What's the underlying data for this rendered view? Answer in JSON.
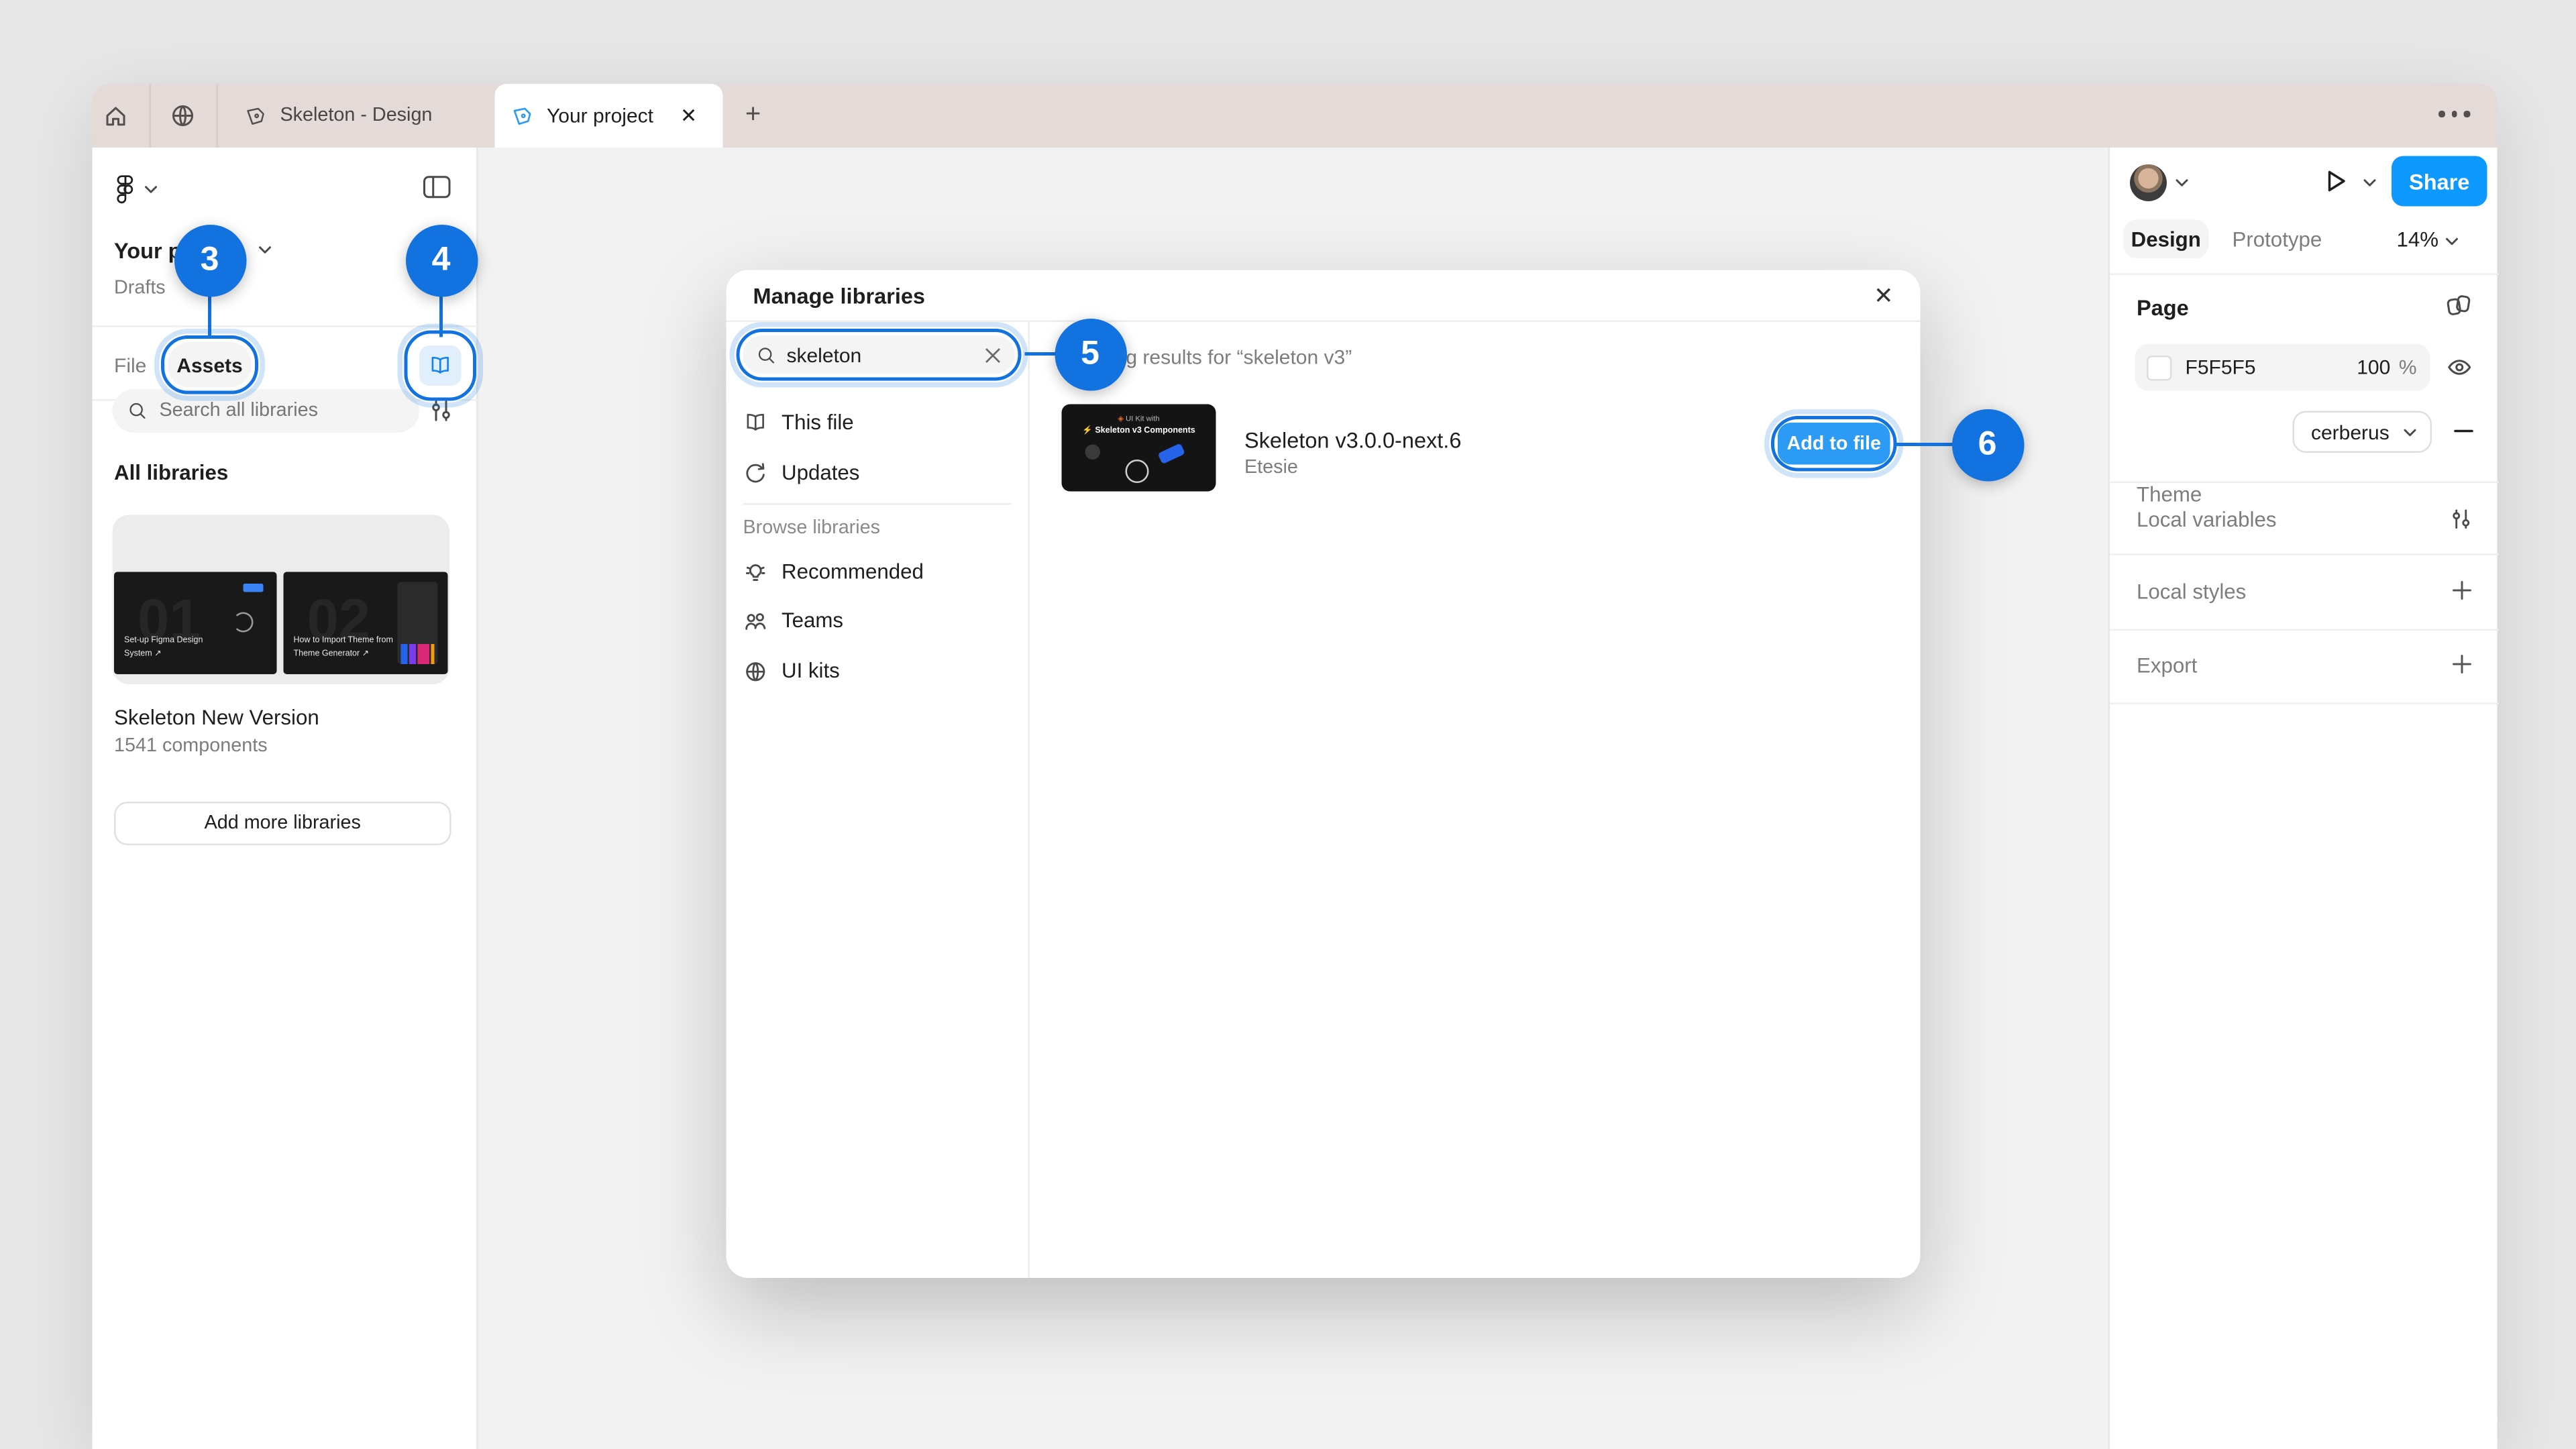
{
  "tabbar": {
    "doc_tab": "Skeleton - Design",
    "active_tab": "Your project"
  },
  "left_sidebar": {
    "project_title": "Your project",
    "subtitle": "Drafts",
    "tab_file": "File",
    "tab_assets": "Assets",
    "search_placeholder": "Search all libraries",
    "section_all_libraries": "All libraries",
    "card": {
      "thumb1_caption": "Set-up Figma Design System ↗",
      "thumb1_watermark": "01",
      "thumb2_caption": "How to Import Theme from Theme Generator ↗",
      "thumb2_watermark": "02"
    },
    "library_name": "Skeleton New Version",
    "library_meta": "1541 components",
    "add_more_button": "Add more libraries"
  },
  "modal": {
    "title": "Manage libraries",
    "search_value": "skeleton",
    "nav": {
      "this_file": "This file",
      "updates": "Updates",
      "browse_section": "Browse libraries",
      "recommended": "Recommended",
      "teams": "Teams",
      "ui_kits": "UI kits"
    },
    "results_heading": "Showing results for “skeleton v3”",
    "result": {
      "thumb_line1": "UI Kit with",
      "thumb_line2": "Skeleton v3 Components",
      "title": "Skeleton v3.0.0-next.6",
      "author": "Etesie",
      "action": "Add to file"
    }
  },
  "right_panel": {
    "share": "Share",
    "tab_design": "Design",
    "tab_prototype": "Prototype",
    "zoom_level": "14%",
    "page_section": "Page",
    "page_color_hex": "F5F5F5",
    "page_opacity": "100",
    "percent_sign": "%",
    "theme_label": "Theme",
    "theme_value": "cerberus",
    "local_variables": "Local variables",
    "local_styles": "Local styles",
    "export": "Export"
  },
  "annotations": {
    "step3": "3",
    "step4": "4",
    "step5": "5",
    "step6": "6"
  },
  "colors": {
    "accent_blue": "#1172E0",
    "add_button_blue": "#2B9BF5",
    "share_blue": "#0D99FF",
    "tabbar_pink": "#E4DAD7",
    "page_color": "#F5F5F5"
  }
}
